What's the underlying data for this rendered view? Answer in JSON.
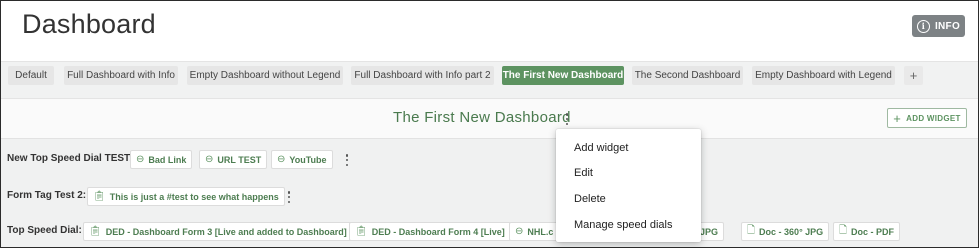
{
  "header": {
    "title": "Dashboard",
    "info_label": "INFO",
    "info_icon": "info-icon"
  },
  "tabs": [
    {
      "label": "Default"
    },
    {
      "label": "Full Dashboard with Info"
    },
    {
      "label": "Empty Dashboard without Legend"
    },
    {
      "label": "Full Dashboard with Info part 2"
    },
    {
      "label": "The First New Dashboard",
      "active": true
    },
    {
      "label": "The Second Dashboard"
    },
    {
      "label": "Empty Dashboard with Legend"
    },
    {
      "label": "+"
    }
  ],
  "dashboard": {
    "title": "The First New Dashboard",
    "add_widget_label": "ADD WIDGET"
  },
  "rows": [
    {
      "label": "New Top Speed Dial TEST:",
      "chips": [
        {
          "label": "Bad Link",
          "icon": "link-icon"
        },
        {
          "label": "URL TEST",
          "icon": "link-icon"
        },
        {
          "label": "YouTube",
          "icon": "link-icon"
        }
      ]
    },
    {
      "label": "Form Tag Test 2:",
      "chips": [
        {
          "label": "This is just a #test to see what happens",
          "icon": "clipboard-icon"
        }
      ]
    },
    {
      "label": "Top Speed Dial:",
      "chips": [
        {
          "label": "DED - Dashboard Form 3 [Live and added to Dashboard]",
          "icon": "clipboard-icon"
        },
        {
          "label": "DED - Dashboard Form 4 [Live]",
          "icon": "clipboard-icon"
        },
        {
          "label": "NHL.c",
          "icon": "link-icon"
        },
        {
          "label": "c - JPG",
          "icon": "document-icon"
        },
        {
          "label": "Doc - 360° JPG",
          "icon": "document-icon"
        },
        {
          "label": "Doc - PDF",
          "icon": "document-icon"
        }
      ]
    }
  ],
  "context_menu": {
    "items": [
      "Add widget",
      "Edit",
      "Delete",
      "Manage speed dials"
    ]
  },
  "colors": {
    "accent": "#5d9361",
    "info_button": "#7d8285"
  }
}
